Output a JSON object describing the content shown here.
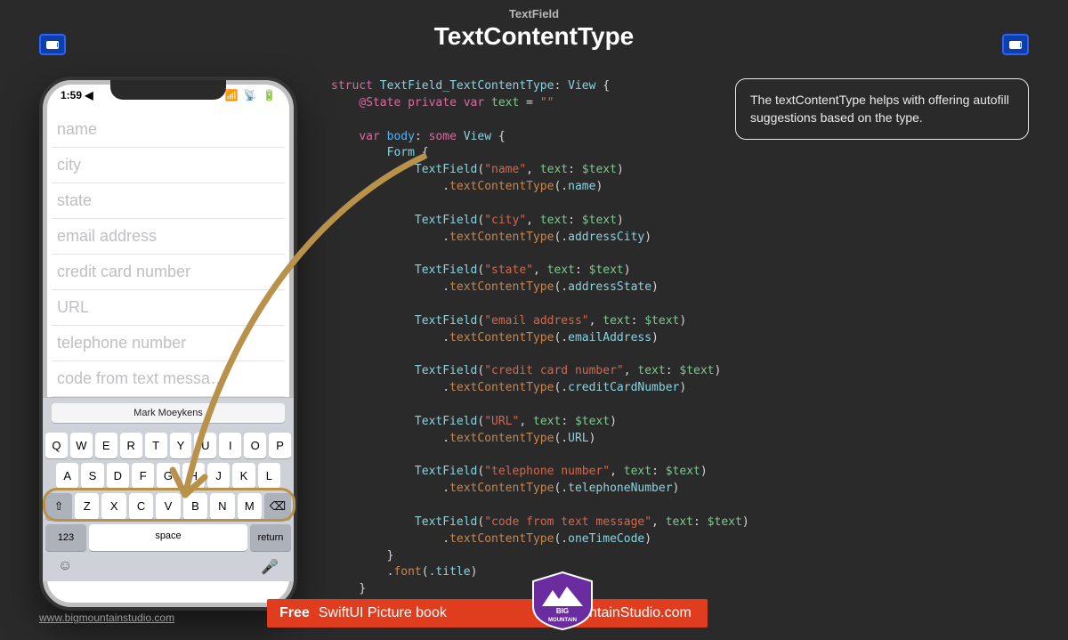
{
  "header": {
    "subtitle": "TextField",
    "title": "TextContentType"
  },
  "phone": {
    "statusbar": {
      "time": "1:59 ◀",
      "signal": "▪▪▮",
      "wifi": "􀙇",
      "battery": "▮"
    },
    "fields": [
      "name",
      "city",
      "state",
      "email address",
      "credit card number",
      "URL",
      "telephone number",
      "code from text messa…"
    ],
    "autofill_suggestion": "Mark Moeykens",
    "keyboard": {
      "row1": [
        "Q",
        "W",
        "E",
        "R",
        "T",
        "Y",
        "U",
        "I",
        "O",
        "P"
      ],
      "row2": [
        "A",
        "S",
        "D",
        "F",
        "G",
        "H",
        "J",
        "K",
        "L"
      ],
      "row3_shift": "⇧",
      "row3": [
        "Z",
        "X",
        "C",
        "V",
        "B",
        "N",
        "M"
      ],
      "row3_del": "⌫",
      "row4_numbers": "123",
      "row4_space": "space",
      "row4_return": "return",
      "emoji": "☺",
      "mic": "🎤"
    }
  },
  "callout": {
    "text": "The textContentType helps with offering autofill suggestions based on the type."
  },
  "code": {
    "struct_name": "TextField_TextContentType",
    "state_var": "text",
    "state_init": "\"\"",
    "textfields": [
      {
        "label": "name",
        "type": "name"
      },
      {
        "label": "city",
        "type": "addressCity"
      },
      {
        "label": "state",
        "type": "addressState"
      },
      {
        "label": "email address",
        "type": "emailAddress"
      },
      {
        "label": "credit card number",
        "type": "creditCardNumber"
      },
      {
        "label": "URL",
        "type": "URL"
      },
      {
        "label": "telephone number",
        "type": "telephoneNumber"
      },
      {
        "label": "code from text message",
        "type": "oneTimeCode"
      }
    ],
    "font_modifier": ".title"
  },
  "footer": {
    "url": "www.bigmountainstudio.com",
    "banner_free": "Free",
    "banner_text1": "SwiftUI Picture book",
    "banner_text2": "BigMountainStudio.com",
    "logo_top": "BIG",
    "logo_bottom": "MOUNTAIN"
  }
}
